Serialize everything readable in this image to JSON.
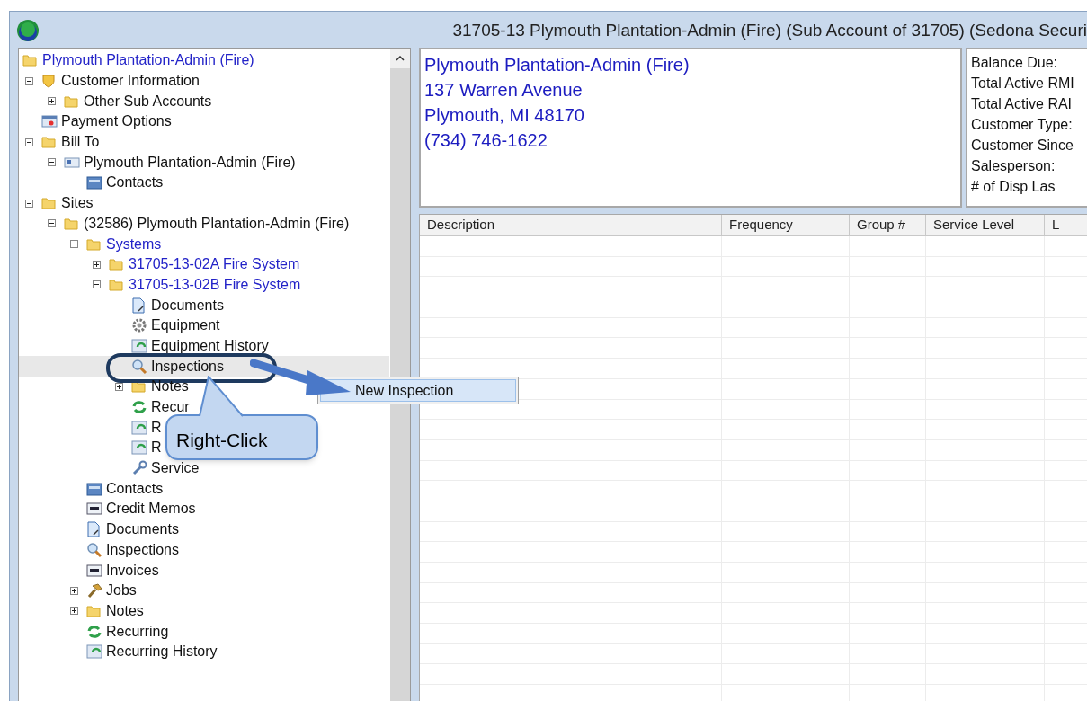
{
  "window": {
    "title": "31705-13  Plymouth Plantation-Admin (Fire)  (Sub Account of 31705) (Sedona Securi"
  },
  "tree": [
    {
      "label": "Plymouth Plantation-Admin (Fire)",
      "kind": "folder",
      "link": true,
      "selected": false,
      "children": [
        {
          "label": "Customer Information",
          "kind": "shield",
          "link": false,
          "selected": false,
          "expanded": true,
          "children": [
            {
              "label": "Other Sub Accounts",
              "kind": "folder",
              "link": false,
              "selected": false,
              "expanded": false
            }
          ]
        },
        {
          "label": "Payment Options",
          "kind": "payment",
          "link": false,
          "selected": false
        },
        {
          "label": "Bill To",
          "kind": "folder",
          "link": false,
          "selected": false,
          "expanded": true,
          "children": [
            {
              "label": "Plymouth Plantation-Admin (Fire)",
              "kind": "card",
              "link": false,
              "selected": false,
              "expanded": true,
              "children": [
                {
                  "label": "Contacts",
                  "kind": "contact",
                  "link": false,
                  "selected": false
                }
              ]
            }
          ]
        },
        {
          "label": "Sites",
          "kind": "folder",
          "link": false,
          "selected": false,
          "expanded": true,
          "children": [
            {
              "label": "(32586) Plymouth Plantation-Admin (Fire)",
              "kind": "folder",
              "link": false,
              "selected": false,
              "expanded": true,
              "children": [
                {
                  "label": "Systems",
                  "kind": "folder",
                  "link": true,
                  "selected": false,
                  "expanded": true,
                  "children": [
                    {
                      "label": "31705-13-02A  Fire System",
                      "kind": "folder",
                      "link": true,
                      "selected": false,
                      "expanded": false
                    },
                    {
                      "label": "31705-13-02B  Fire System",
                      "kind": "folder",
                      "link": true,
                      "selected": false,
                      "expanded": true,
                      "children": [
                        {
                          "label": "Documents",
                          "kind": "document",
                          "link": false,
                          "selected": false
                        },
                        {
                          "label": "Equipment",
                          "kind": "gear",
                          "link": false,
                          "selected": false
                        },
                        {
                          "label": "Equipment History",
                          "kind": "history",
                          "link": false,
                          "selected": false
                        },
                        {
                          "label": "Inspections",
                          "kind": "search",
                          "link": false,
                          "selected": true
                        },
                        {
                          "label": "Notes",
                          "kind": "folder",
                          "link": false,
                          "selected": false,
                          "expanded": false
                        },
                        {
                          "label": "Recur",
                          "kind": "recurring",
                          "link": false,
                          "selected": false
                        },
                        {
                          "label": "R",
                          "kind": "history",
                          "link": false,
                          "selected": false
                        },
                        {
                          "label": "R",
                          "kind": "history",
                          "link": false,
                          "selected": false
                        },
                        {
                          "label": "Service",
                          "kind": "wrench",
                          "link": false,
                          "selected": false
                        }
                      ]
                    }
                  ]
                },
                {
                  "label": "Contacts",
                  "kind": "contact",
                  "link": false,
                  "selected": false
                },
                {
                  "label": "Credit Memos",
                  "kind": "memo",
                  "link": false,
                  "selected": false
                },
                {
                  "label": "Documents",
                  "kind": "document",
                  "link": false,
                  "selected": false
                },
                {
                  "label": "Inspections",
                  "kind": "search",
                  "link": false,
                  "selected": false
                },
                {
                  "label": "Invoices",
                  "kind": "memo",
                  "link": false,
                  "selected": false
                },
                {
                  "label": "Jobs",
                  "kind": "hammer",
                  "link": false,
                  "selected": false,
                  "expanded": false
                },
                {
                  "label": "Notes",
                  "kind": "folder",
                  "link": false,
                  "selected": false,
                  "expanded": false
                },
                {
                  "label": "Recurring",
                  "kind": "recurring",
                  "link": false,
                  "selected": false
                },
                {
                  "label": "Recurring History",
                  "kind": "history",
                  "link": false,
                  "selected": false
                }
              ]
            }
          ]
        }
      ]
    }
  ],
  "address": [
    "Plymouth Plantation-Admin (Fire)",
    "137 Warren Avenue",
    "Plymouth, MI 48170",
    "(734) 746-1622"
  ],
  "summary": [
    "Balance Due:",
    "Total Active RMI",
    "Total Active RAI",
    "Customer Type:",
    "Customer Since",
    "Salesperson:",
    "# of Disp Las"
  ],
  "table": {
    "columns": [
      "Description",
      "Frequency",
      "Group #",
      "Service Level",
      "L"
    ]
  },
  "context_menu": {
    "items": [
      "New Inspection"
    ]
  },
  "callout": {
    "text": "Right-Click"
  }
}
